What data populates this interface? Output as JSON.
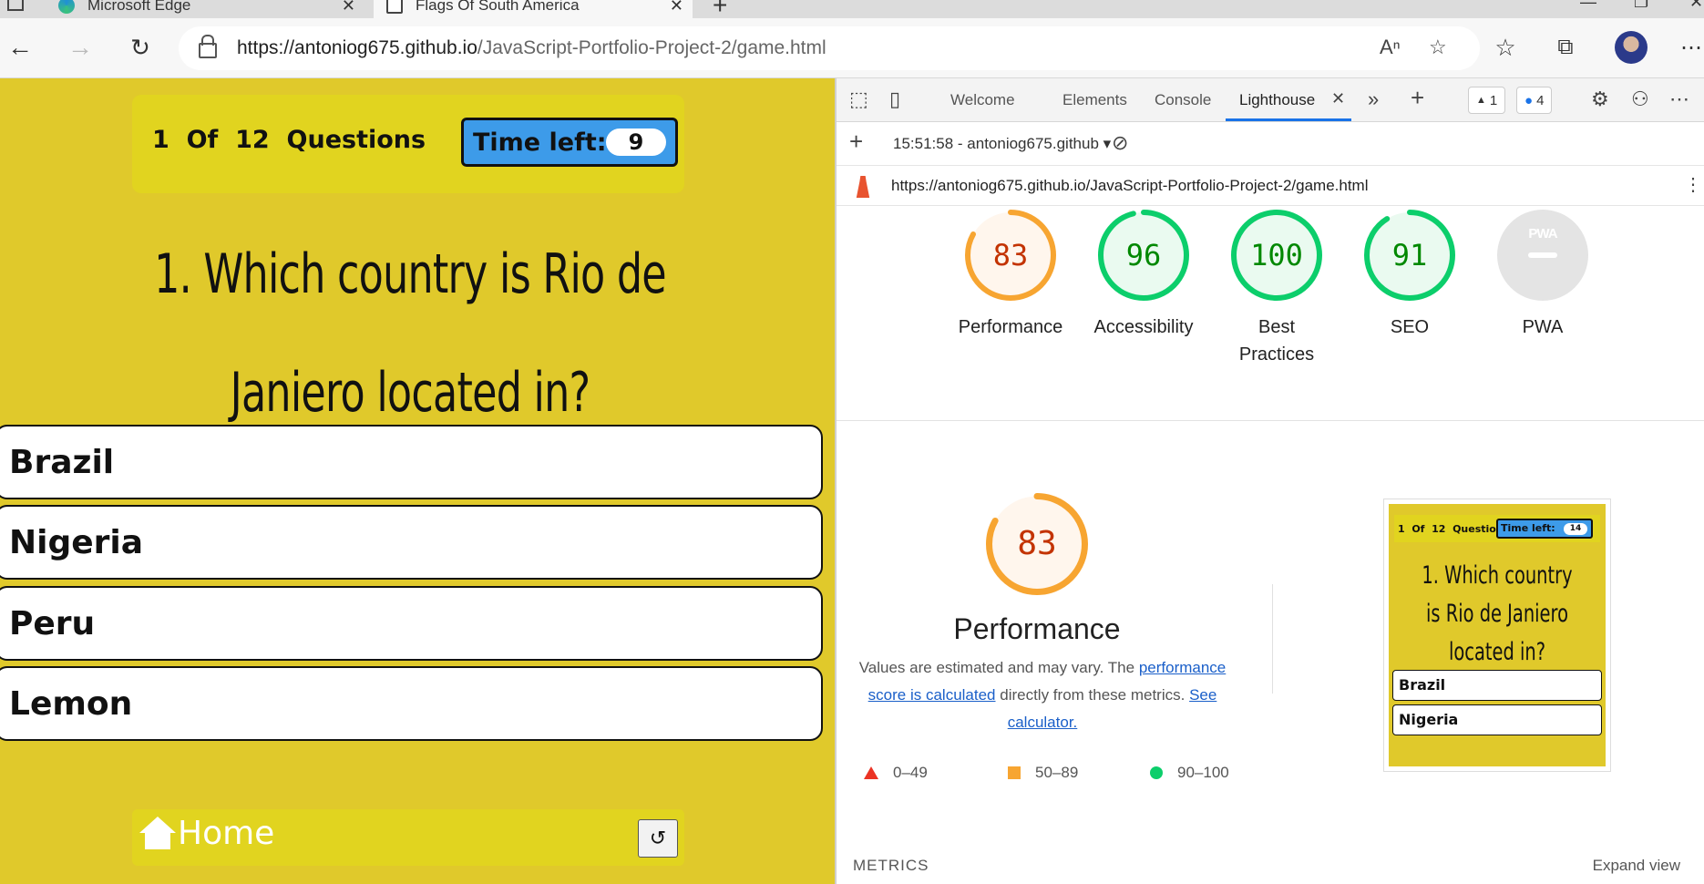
{
  "browser": {
    "tabs": [
      {
        "title": "Microsoft Edge"
      },
      {
        "title": "Flags Of South America"
      }
    ],
    "address": {
      "host": "https://antoniog675.github.io",
      "path": "/JavaScript-Portfolio-Project-2/game.html"
    },
    "icons": [
      "back-icon",
      "forward-icon",
      "refresh-icon",
      "lock-icon",
      "read-aloud-icon",
      "add-favorite-icon",
      "favorites-icon",
      "collections-icon",
      "more-icon"
    ]
  },
  "game": {
    "count_num": "1",
    "count_of": "Of",
    "count_total": "12",
    "count_label": "Questions",
    "timer_label": "Time left:",
    "timer_value": "9",
    "question": "1. Which country is Rio de Janiero located in?",
    "answers": [
      "Brazil",
      "Nigeria",
      "Peru",
      "Lemon"
    ],
    "home_label": "Home",
    "restart_icon": "restart-icon",
    "colors": {
      "background": "#e0c92b",
      "header": "#e1d41f",
      "timer": "#3d9be9"
    }
  },
  "devtools": {
    "tabs": [
      "Welcome",
      "Elements",
      "Console",
      "Lighthouse"
    ],
    "active_tab": "Lighthouse",
    "warnings": "1",
    "messages": "4",
    "report_time": "15:51:58 - antoniog675.github",
    "report_url": "https://antoniog675.github.io/JavaScript-Portfolio-Project-2/game.html",
    "scores": [
      {
        "label": "Performance",
        "value": 83,
        "color": "#f7a531",
        "text_color": "#c33300",
        "fill": "#fff6ed"
      },
      {
        "label": "Accessibility",
        "value": 96,
        "color": "#0cce6b",
        "text_color": "#008800",
        "fill": "#eafaf0"
      },
      {
        "label": "Best Practices",
        "value": 100,
        "color": "#0cce6b",
        "text_color": "#008800",
        "fill": "#eafaf0"
      },
      {
        "label": "SEO",
        "value": 91,
        "color": "#0cce6b",
        "text_color": "#008800",
        "fill": "#eafaf0"
      },
      {
        "label": "PWA",
        "value": null,
        "badge": "PWA"
      }
    ],
    "performance": {
      "score": 83,
      "title": "Performance",
      "desc_1": "Values are estimated and may vary. The ",
      "link_1": "performance score is calculated",
      "desc_2": " directly from these metrics. ",
      "link_2": "See calculator.",
      "legend": [
        "0–49",
        "50–89",
        "90–100"
      ]
    },
    "thumbnail": {
      "count": "1  Of  12  Questions",
      "timer_label": "Time left:",
      "timer_value": "14",
      "question": "1. Which country is Rio de Janiero located in?",
      "answers": [
        "Brazil",
        "Nigeria"
      ]
    },
    "metrics_label": "METRICS",
    "expand_label": "Expand view"
  }
}
